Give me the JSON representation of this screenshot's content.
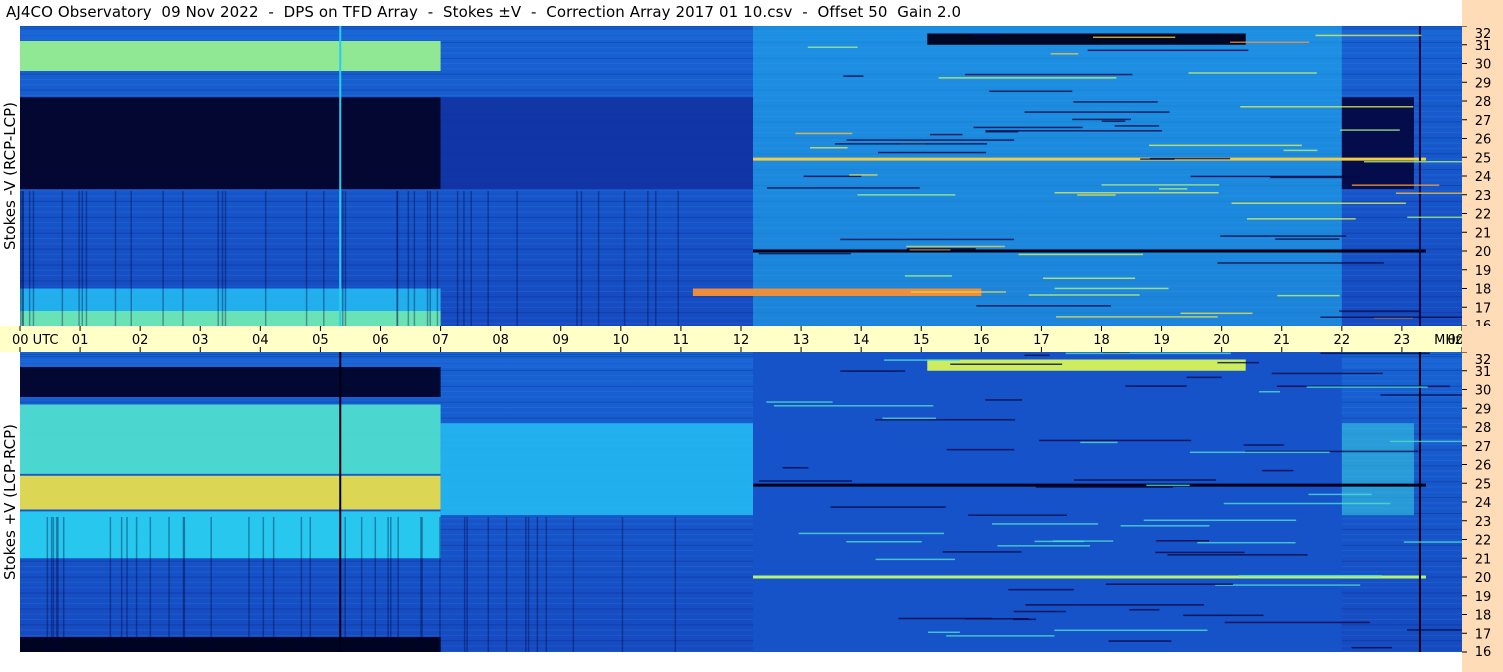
{
  "title": "AJ4CO Observatory  09 Nov 2022  -  DPS on TFD Array  -  Stokes ±V  -  Correction Array 2017 01 10.csv  -  Offset 50  Gain 2.0",
  "colors": {
    "time_axis_bg": "#ffffc8",
    "freq_axis_bg": "#ffdcb8",
    "background_blue": "#1646b8"
  },
  "chart_data": [
    {
      "type": "heatmap",
      "panel": "top",
      "ylabel": "Stokes -V (RCP-LCP)",
      "y_unit": "MHz",
      "y_ticks": [
        16,
        17,
        18,
        19,
        20,
        21,
        22,
        23,
        24,
        25,
        26,
        27,
        28,
        29,
        30,
        31,
        32
      ],
      "ylim": [
        16,
        32
      ],
      "xlim": [
        0,
        24
      ],
      "features": [
        {
          "kind": "freq_band",
          "x": [
            0,
            7
          ],
          "y": [
            29.6,
            31.2
          ],
          "level": 0.72
        },
        {
          "kind": "freq_band",
          "x": [
            0,
            7
          ],
          "y": [
            23.3,
            28.2
          ],
          "level": 0.02
        },
        {
          "kind": "freq_band",
          "x": [
            7,
            12.2
          ],
          "y": [
            23.3,
            28.2
          ],
          "level": 0.2
        },
        {
          "kind": "freq_band",
          "x": [
            0,
            7
          ],
          "y": [
            16,
            16.8
          ],
          "level": 0.68
        },
        {
          "kind": "freq_band",
          "x": [
            0,
            7
          ],
          "y": [
            16.8,
            18
          ],
          "level": 0.5
        },
        {
          "kind": "freq_band",
          "x": [
            12.2,
            22
          ],
          "y": [
            16,
            32
          ],
          "level": 0.5
        },
        {
          "kind": "freq_band",
          "x": [
            22,
            23.2
          ],
          "y": [
            23.3,
            28.2
          ],
          "level": 0.05
        },
        {
          "kind": "freq_band",
          "x": [
            15.1,
            20.4
          ],
          "y": [
            31,
            31.6
          ],
          "level": 0.0
        },
        {
          "kind": "freq_band",
          "x": [
            11.2,
            16
          ],
          "y": [
            17.6,
            18
          ],
          "level": 0.92
        },
        {
          "kind": "freq_line",
          "x": [
            12.2,
            23.4
          ],
          "y": 24.9,
          "level": 0.85
        },
        {
          "kind": "freq_line",
          "x": [
            12.2,
            23.4
          ],
          "y": 20.0,
          "level": 0.0
        },
        {
          "kind": "time_line",
          "x": 5.33,
          "level": 0.55
        },
        {
          "kind": "time_line",
          "x": 23.3,
          "level": 0.05
        }
      ]
    },
    {
      "type": "heatmap",
      "panel": "bottom",
      "ylabel": "Stokes +V (LCP-RCP)",
      "y_unit": "MHz",
      "y_ticks": [
        16,
        17,
        18,
        19,
        20,
        21,
        22,
        23,
        24,
        25,
        26,
        27,
        28,
        29,
        30,
        31,
        32
      ],
      "ylim": [
        16,
        32
      ],
      "xlim": [
        0,
        24
      ],
      "features": [
        {
          "kind": "freq_band",
          "x": [
            0,
            7
          ],
          "y": [
            29.6,
            31.2
          ],
          "level": 0.02
        },
        {
          "kind": "freq_band",
          "x": [
            0,
            7
          ],
          "y": [
            25.5,
            29.2
          ],
          "level": 0.62
        },
        {
          "kind": "freq_band",
          "x": [
            0,
            7
          ],
          "y": [
            23.6,
            25.4
          ],
          "level": 0.82
        },
        {
          "kind": "freq_band",
          "x": [
            0,
            7
          ],
          "y": [
            21,
            23.5
          ],
          "level": 0.55
        },
        {
          "kind": "freq_band",
          "x": [
            0,
            7
          ],
          "y": [
            16,
            16.8
          ],
          "level": 0.0
        },
        {
          "kind": "freq_band",
          "x": [
            7,
            12.2
          ],
          "y": [
            23.3,
            28.2
          ],
          "level": 0.5
        },
        {
          "kind": "freq_band",
          "x": [
            12.2,
            22
          ],
          "y": [
            16,
            32
          ],
          "level": 0.28
        },
        {
          "kind": "freq_band",
          "x": [
            22,
            23.2
          ],
          "y": [
            23.3,
            28.2
          ],
          "level": 0.58
        },
        {
          "kind": "freq_band",
          "x": [
            15.1,
            20.4
          ],
          "y": [
            31,
            31.6
          ],
          "level": 0.78
        },
        {
          "kind": "freq_line",
          "x": [
            12.2,
            23.4
          ],
          "y": 24.9,
          "level": 0.0
        },
        {
          "kind": "freq_line",
          "x": [
            12.2,
            23.4
          ],
          "y": 20.0,
          "level": 0.75
        },
        {
          "kind": "time_line",
          "x": 5.33,
          "level": 0.0
        },
        {
          "kind": "time_line",
          "x": 23.3,
          "level": 0.0
        }
      ]
    }
  ],
  "time_axis": {
    "labels": [
      "00  UTC",
      "01",
      "02",
      "03",
      "04",
      "05",
      "06",
      "07",
      "08",
      "09",
      "10",
      "11",
      "12",
      "13",
      "14",
      "15",
      "16",
      "17",
      "18",
      "19",
      "20",
      "21",
      "22",
      "23",
      "00"
    ],
    "unit_label": "MHz"
  }
}
